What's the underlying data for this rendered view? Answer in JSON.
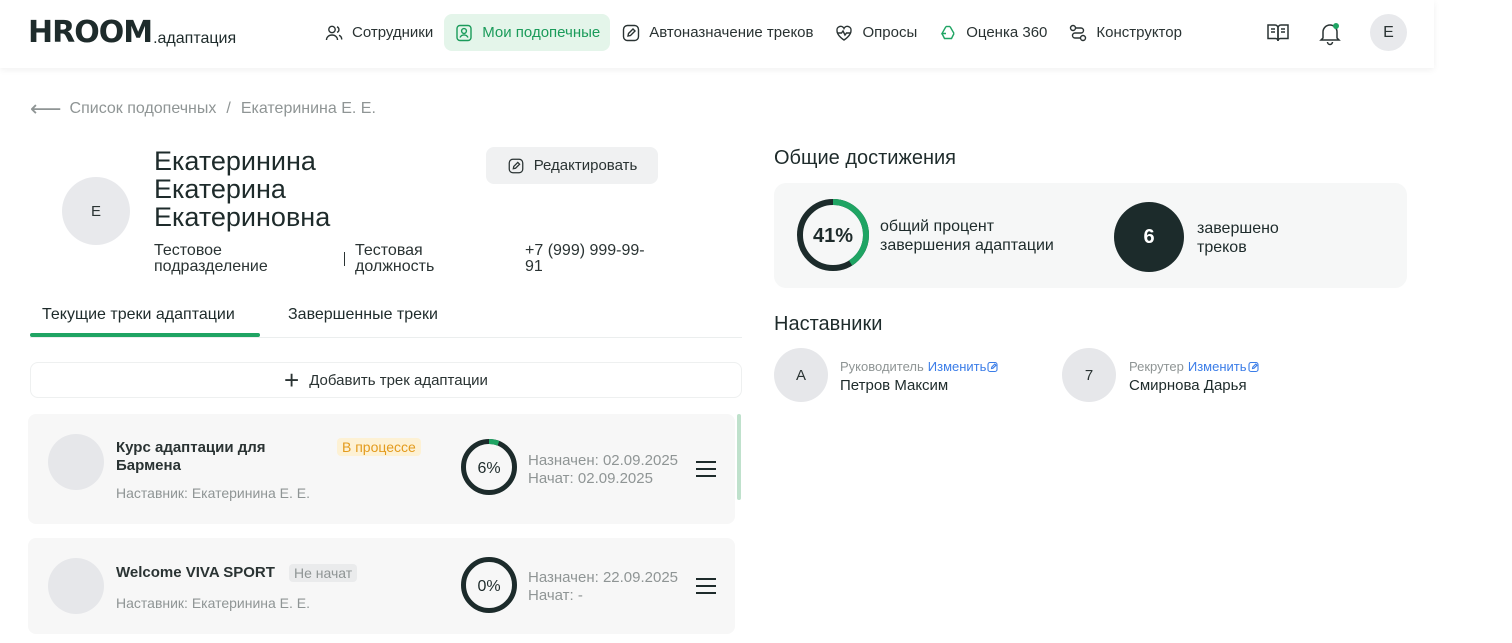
{
  "header": {
    "logo_main": "HROOM",
    "logo_sub": ".адаптация",
    "nav": [
      {
        "label": "Сотрудники",
        "icon": "users-icon"
      },
      {
        "label": "Мои подопечные",
        "icon": "user-badge-icon",
        "active": true
      },
      {
        "label": "Автоназначение треков",
        "icon": "edit-pen-icon"
      },
      {
        "label": "Опросы",
        "icon": "heart-pulse-icon"
      },
      {
        "label": "Оценка 360",
        "icon": "recycle-icon"
      },
      {
        "label": "Конструктор",
        "icon": "route-icon"
      }
    ],
    "icons": [
      "book-icon",
      "bell-icon"
    ],
    "avatar": "Е"
  },
  "breadcrumb": {
    "back": "Список подопечных",
    "separator": "/",
    "current": "Екатеринина Е. Е."
  },
  "profile": {
    "avatar": "Е",
    "name_line1": "Екатеринина",
    "name_line2": "Екатерина",
    "name_line3": "Екатериновна",
    "edit_label": "Редактировать",
    "department_line1": "Тестовое",
    "department_line2": "подразделение",
    "position_line1": "Тестовая",
    "position_line2": "должность",
    "phone_line1": "+7 (999) 999-99-",
    "phone_line2": "91"
  },
  "tabs": [
    {
      "label": "Текущие треки адаптации",
      "active": true
    },
    {
      "label": "Завершенные треки"
    }
  ],
  "add_track_label": "Добавить трек адаптации",
  "tracks": [
    {
      "title_line1": "Курс адаптации для",
      "title_line2": "Бармена",
      "status": "В процессе",
      "mentor": "Наставник: Екатеринина Е. Е.",
      "progress_label": "6%",
      "progress": 0.06,
      "assigned": "Назначен: 02.09.2025",
      "started": "Начат: 02.09.2025"
    },
    {
      "title_line1": "Welcome VIVA SPORT",
      "title_line2": "",
      "status": "Не начат",
      "mentor": "Наставник: Екатеринина Е. Е.",
      "progress_label": "0%",
      "progress": 0,
      "assigned": "Назначен: 22.09.2025",
      "started": "Начат: -"
    }
  ],
  "achievements": {
    "title": "Общие достижения",
    "percent_label": "41%",
    "percent": 0.41,
    "percent_text_line1": "общий процент",
    "percent_text_line2": "завершения адаптации",
    "completed_count": "6",
    "completed_text_line1": "завершено",
    "completed_text_line2": "треков"
  },
  "mentors": {
    "title": "Наставники",
    "change_label": "Изменить",
    "items": [
      {
        "avatar": "А",
        "role": "Руководитель",
        "name": "Петров Максим"
      },
      {
        "avatar": "7",
        "role": "Рекрутер",
        "name": "Смирнова Дарья"
      }
    ]
  },
  "colors": {
    "accent": "#1fa463",
    "accent_bg": "#e4f5ea",
    "dark": "#1c2b2b",
    "link": "#3b7de8",
    "status_progress": "#e39b1d"
  }
}
